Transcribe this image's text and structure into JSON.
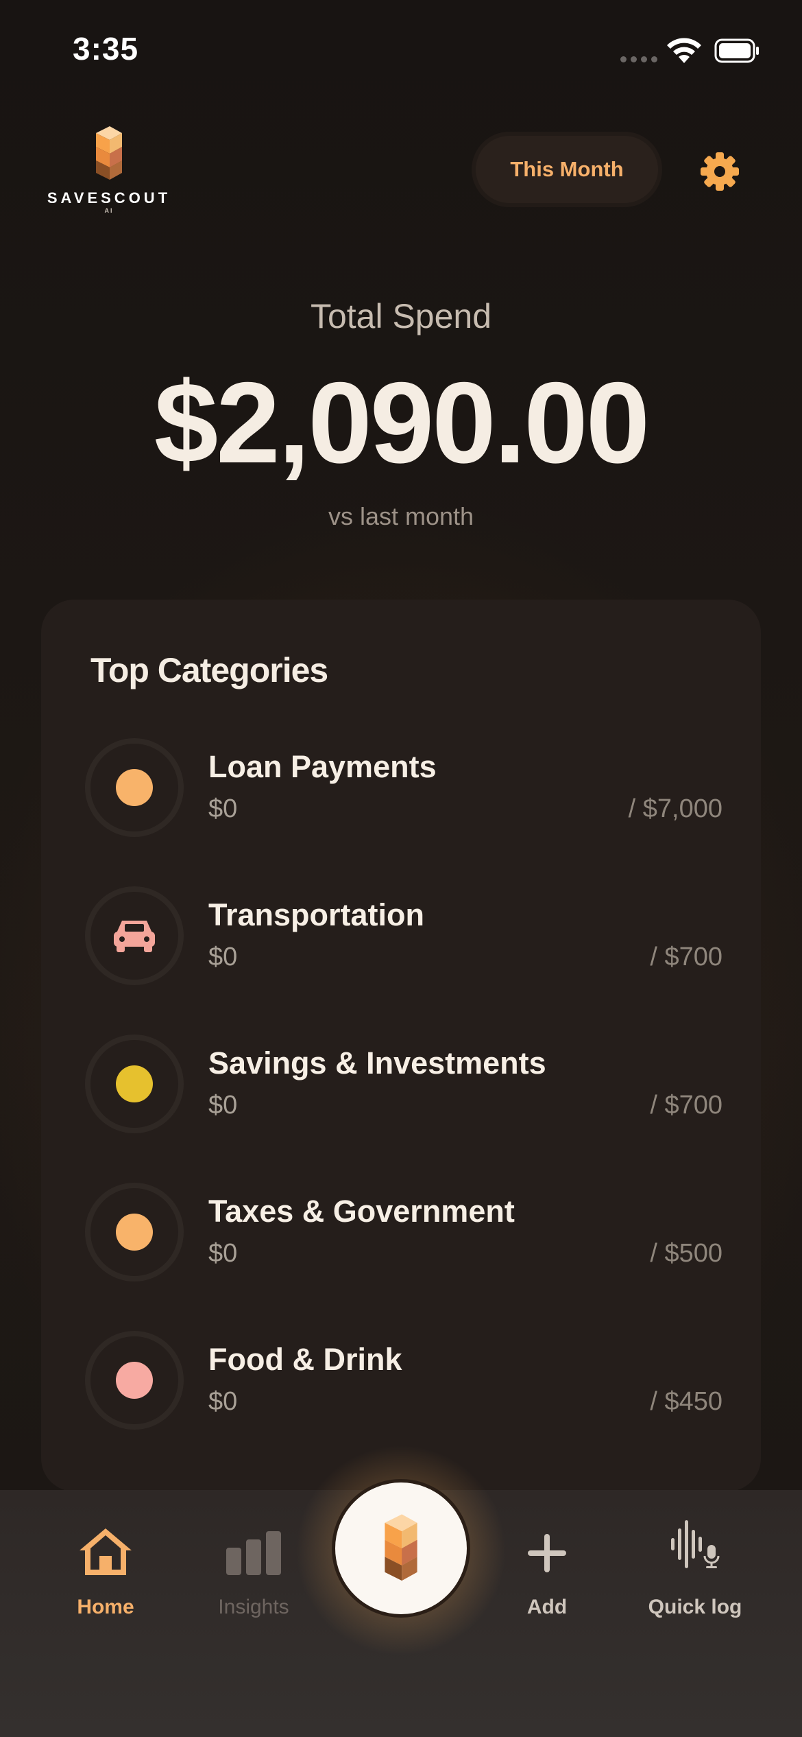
{
  "status_bar": {
    "time": "3:35"
  },
  "brand": {
    "name": "SAVESCOUT",
    "sub": "AI"
  },
  "header": {
    "period_label": "This Month"
  },
  "summary": {
    "label": "Total Spend",
    "amount": "$2,090.00",
    "comparison": "vs last month"
  },
  "categories": {
    "title": "Top Categories",
    "items": [
      {
        "name": "Loan Payments",
        "spent": "$0",
        "budget": "/ $7,000",
        "icon": "dot",
        "color": "#f8b36a"
      },
      {
        "name": "Transportation",
        "spent": "$0",
        "budget": "/ $700",
        "icon": "car-icon",
        "color": "#f3a59a"
      },
      {
        "name": "Savings & Investments",
        "spent": "$0",
        "budget": "/ $700",
        "icon": "dot",
        "color": "#e6c12e"
      },
      {
        "name": "Taxes & Government",
        "spent": "$0",
        "budget": "/ $500",
        "icon": "dot",
        "color": "#f8b36a"
      },
      {
        "name": "Food & Drink",
        "spent": "$0",
        "budget": "/ $450",
        "icon": "dot",
        "color": "#f7aaa2"
      }
    ]
  },
  "nav": {
    "items": [
      {
        "label": "Home",
        "icon": "home-icon",
        "active": true,
        "color": "#f6b06a"
      },
      {
        "label": "Insights",
        "icon": "bar-chart-icon",
        "active": false,
        "color": "#6e6560"
      },
      {
        "label": "Add",
        "icon": "plus-icon",
        "active": false,
        "color": "#cfc6bd"
      },
      {
        "label": "Quick log",
        "icon": "voice-icon",
        "active": false,
        "color": "#cfc6bd"
      }
    ],
    "center_button": "savescout-logo-icon"
  }
}
